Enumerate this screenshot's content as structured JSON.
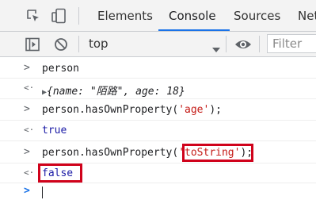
{
  "tabs": [
    "Elements",
    "Console",
    "Sources",
    "Net"
  ],
  "active_tab": "Console",
  "toolbar": {
    "context": "top",
    "filter_placeholder": "Filter"
  },
  "console": {
    "lines": [
      {
        "type": "input",
        "prompt": ">",
        "text": "person"
      },
      {
        "type": "output-object",
        "prompt": "<·",
        "expand": "▶",
        "open": "{",
        "k1": "name",
        "colon1": ": ",
        "v1": "\"陌路\"",
        "sep": ", ",
        "k2": "age",
        "colon2": ": ",
        "v2": "18",
        "close": "}"
      },
      {
        "type": "input",
        "prompt": ">",
        "pre": "person.hasOwnProperty(",
        "arg": "'age'",
        "post": ");"
      },
      {
        "type": "output",
        "prompt": "<·",
        "text": "true"
      },
      {
        "type": "input",
        "prompt": ">",
        "pre": "person.hasOwnProperty(",
        "arg": "'toString'",
        "post": ");"
      },
      {
        "type": "output",
        "prompt": "<·",
        "text": "false"
      }
    ],
    "input_prompt": ">"
  },
  "colors": {
    "accent": "#1a73e8",
    "highlight_box": "#d0021b",
    "string": "#c41a16",
    "number": "#1c00cf",
    "keyword": "#1a1aa6",
    "prompt_blue": "#1a73e8"
  },
  "icons": [
    "inspect-icon",
    "device-toggle-icon",
    "sidebar-toggle-icon",
    "clear-console-icon",
    "dropdown-arrow-icon",
    "eye-icon"
  ]
}
